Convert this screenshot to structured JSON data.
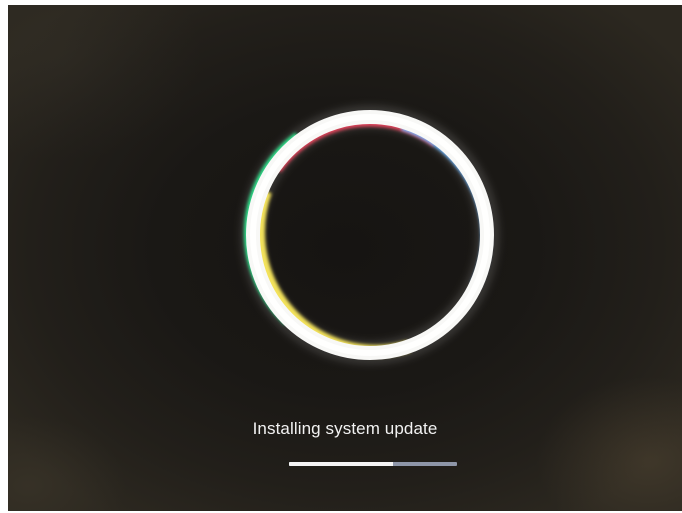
{
  "screen": {
    "status_text": "Installing system update",
    "progress": {
      "fraction": 0.62
    },
    "spinner": {
      "icon": "multicolor-ring-spinner-icon",
      "colors": {
        "white": "#f8f8f6",
        "green": "#2ee08a",
        "yellow": "#f3e25a",
        "red": "#e2435a",
        "blue": "#6fb7ff"
      }
    },
    "background_color": "#1a1815"
  }
}
